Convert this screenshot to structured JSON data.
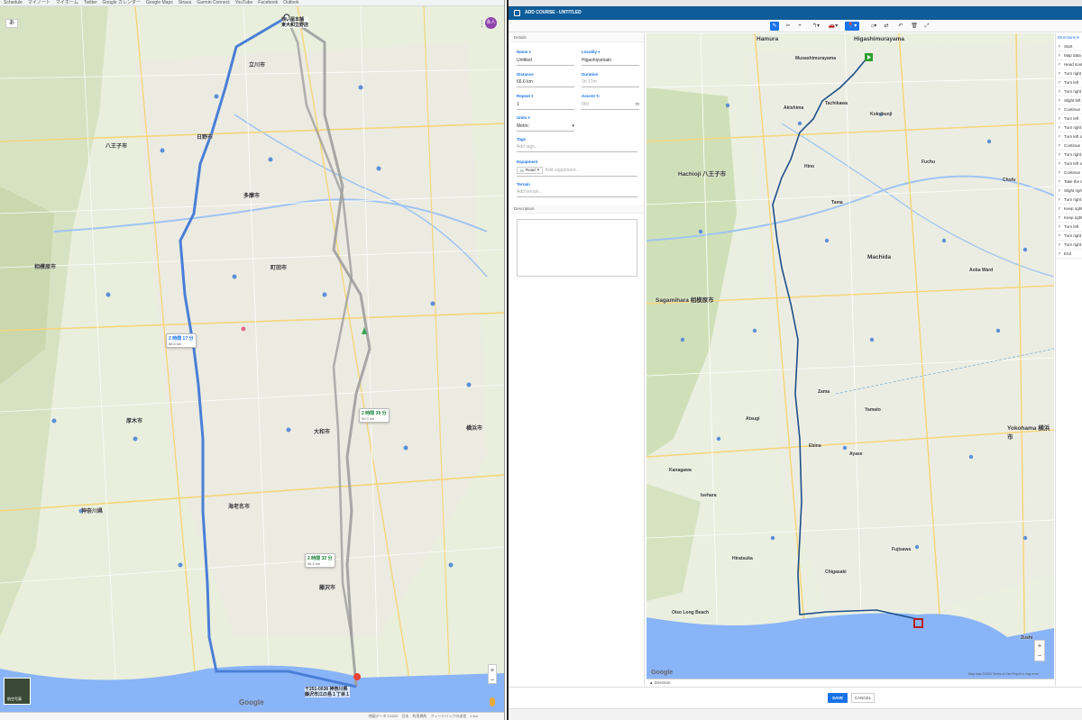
{
  "gmaps": {
    "tabs": [
      "Schedule",
      "マイノート",
      "マイホーム",
      "Twitter",
      "Google カレンダー",
      "Google Maps",
      "Strava",
      "Garmin Connect",
      "YouTube",
      "Facebook",
      "Outlook"
    ],
    "input_mode": "あ",
    "avatar": "永人",
    "origin_label": "西い屋本舗\n東大和立野店",
    "dest_label": "〒251-0036 神奈川県\n藤沢市江の島１丁目１",
    "aerial_label": "航空写真",
    "google_logo": "Google",
    "statusbar": "地図データ ©2020　日本　利用規約　フィードバックの送信　2 km",
    "routes": [
      {
        "time": "2 時間 17 分",
        "dist": "66.6 km",
        "selected": true
      },
      {
        "time": "2 時間 39 分",
        "dist": "59.3 km",
        "selected": false
      },
      {
        "time": "2 時間 32 分",
        "dist": "58.3 km",
        "selected": false
      }
    ],
    "cities": [
      {
        "label": "八王子市"
      },
      {
        "label": "相模原市"
      },
      {
        "label": "横浜市"
      },
      {
        "label": "立川市"
      },
      {
        "label": "町田市"
      },
      {
        "label": "神奈川県"
      },
      {
        "label": "厚木市"
      },
      {
        "label": "藤沢市"
      },
      {
        "label": "大和市"
      },
      {
        "label": "日野市"
      },
      {
        "label": "多摩市"
      },
      {
        "label": "海老名市"
      }
    ]
  },
  "addcourse": {
    "title": "ADD COURSE - UNTITLED",
    "toolbar": {
      "pencil": "✎",
      "scissors": "✂",
      "plus": "+",
      "route_select": "↰▾",
      "car": "🚗▾",
      "pin": "📍▾",
      "home": "⌂▾",
      "swap": "⇄",
      "undo": "↶",
      "delete": "🗑",
      "expand": "⤢"
    },
    "details_header": "Details",
    "name_label": "Name ▾",
    "name_value": "Untitled",
    "locality_label": "Locality ▾",
    "locality_value": "Higashiyamato",
    "distance_label": "Distance",
    "distance_value": "66.6 km",
    "duration_label": "Duration",
    "duration_value": "2h 17m",
    "repeat_label": "Repeat ▾",
    "repeat_value": "1",
    "ascent_label": "Ascent",
    "ascent_value": "880",
    "ascent_unit": "m",
    "units_label": "Units ▾",
    "units_value": "Metric",
    "tags_label": "Tags",
    "tags_placeholder": "Add tags...",
    "equipment_label": "Equipment",
    "equipment_chip": "Road",
    "equipment_placeholder": "Add equipment...",
    "terrain_label": "Terrain",
    "terrain_placeholder": "Add terrain...",
    "description_header": "Description",
    "directions_label": "Direction",
    "right_header": "Directions ▾",
    "directions": [
      "Start",
      "Map data",
      "Head south on 多摩湖自転車道",
      "Turn right onto 芋窪街道",
      "Turn left",
      "Turn right",
      "Slight left",
      "Continue",
      "Turn left",
      "Turn right",
      "Turn left onto 都道",
      "Continue",
      "Turn right",
      "Turn left onto 八王子",
      "Continue",
      "Take the exit toward Express",
      "Slight right",
      "Turn right onto 中原街道 246号",
      "Keep right",
      "Keep right",
      "Turn left",
      "Turn right onto 国道",
      "Turn right",
      "End"
    ],
    "save": "SAVE",
    "cancel": "CANCEL",
    "google_logo": "Google",
    "map_attr": "Map data ©2020  Terms of Use  Report a map error",
    "map_cities": [
      {
        "label": "Hamura"
      },
      {
        "label": "Higashimurayama"
      },
      {
        "label": "Musashimurayama"
      },
      {
        "label": "Akishima"
      },
      {
        "label": "Tachikawa"
      },
      {
        "label": "Kokubunji"
      },
      {
        "label": "Hachioji 八王子市"
      },
      {
        "label": "Hino"
      },
      {
        "label": "Fuchu"
      },
      {
        "label": "Chofu"
      },
      {
        "label": "Tama"
      },
      {
        "label": "Machida"
      },
      {
        "label": "Sagamihara 相模原市"
      },
      {
        "label": "Aoba Ward"
      },
      {
        "label": "Zama"
      },
      {
        "label": "Yamato"
      },
      {
        "label": "Atsugi"
      },
      {
        "label": "Ebina"
      },
      {
        "label": "Ayase"
      },
      {
        "label": "Yokohama 横浜市"
      },
      {
        "label": "Kanagawa"
      },
      {
        "label": "Isehara"
      },
      {
        "label": "Fujisawa"
      },
      {
        "label": "Chigasaki"
      },
      {
        "label": "Hiratsuka"
      },
      {
        "label": "Oiso Long Beach"
      },
      {
        "label": "Zushi"
      }
    ]
  },
  "colors": {
    "accent": "#1a73e8",
    "titlebar": "#0e5c99",
    "route": "#4a7fd6",
    "route_alt": "#9e9e9e",
    "course": "#1e4f8a",
    "sea": "#8ab4f8",
    "start_flag": "#2e9e2e",
    "end_flag": "#b71c1c"
  }
}
